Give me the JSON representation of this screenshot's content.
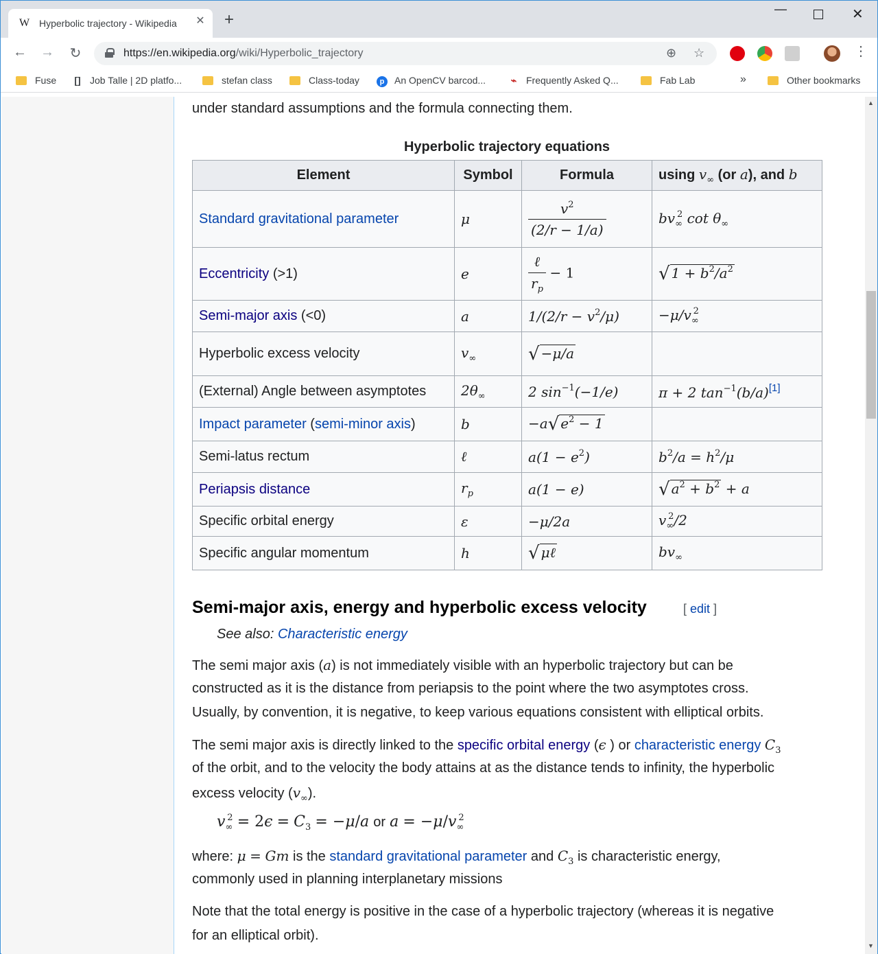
{
  "browser": {
    "tab_title": "Hyperbolic trajectory - Wikipedia",
    "tab_favicon": "W",
    "url_host": "https://en.wikipedia.org",
    "url_path": "/wiki/Hyperbolic_trajectory",
    "bookmarks": [
      {
        "label": "Fuse",
        "icon": "folder-icon"
      },
      {
        "label": "Job Talle | 2D platfo...",
        "icon": "bracket-icon"
      },
      {
        "label": "stefan class",
        "icon": "folder-icon"
      },
      {
        "label": "Class-today",
        "icon": "folder-icon"
      },
      {
        "label": "An OpenCV barcod...",
        "icon": "p-circle-icon"
      },
      {
        "label": "Frequently Asked Q...",
        "icon": "bookmark-graph-icon"
      },
      {
        "label": "Fab Lab",
        "icon": "folder-icon"
      }
    ],
    "bookmarks_overflow": "»",
    "other_bookmarks": "Other bookmarks"
  },
  "article": {
    "intro_tail": "under standard assumptions and the formula connecting them.",
    "table_caption": "Hyperbolic trajectory equations",
    "headers": {
      "element": "Element",
      "symbol": "Symbol",
      "formula": "Formula",
      "using_prefix": "using",
      "using_mid": "(or",
      "using_and": "), and"
    },
    "rows": {
      "r1": {
        "element": "Standard gravitational parameter"
      },
      "r2": {
        "element": "Eccentricity",
        "suffix": "(>1)"
      },
      "r3": {
        "element": "Semi-major axis",
        "suffix": "(<0)"
      },
      "r4": {
        "element": "Hyperbolic excess velocity"
      },
      "r5": {
        "element": "(External) Angle between asymptotes",
        "ref": "[1]"
      },
      "r6": {
        "element": "Impact parameter",
        "paren_link": "semi-minor axis"
      },
      "r7": {
        "element": "Semi-latus rectum"
      },
      "r8": {
        "element": "Periapsis distance"
      },
      "r9": {
        "element": "Specific orbital energy"
      },
      "r10": {
        "element": "Specific angular momentum"
      }
    },
    "section_title": "Semi-major axis, energy and hyperbolic excess velocity",
    "edit_link": "edit",
    "see_also_label": "See also:",
    "see_also_link": "Characteristic energy",
    "para1": {
      "l1a": "The semi major axis (",
      "l1b": ") is not immediately visible with an hyperbolic trajectory but can be",
      "l2": "constructed as it is the distance from periapsis to the point where the two asymptotes cross.",
      "l3": "Usually, by convention, it is negative, to keep various equations consistent with elliptical orbits."
    },
    "para2": {
      "l1a": "The semi major axis is directly linked to the",
      "l1link1": "specific orbital energy",
      "l1b": "(",
      "l1c": ") or",
      "l1link2": "characteristic energy",
      "l2": "of the orbit, and to the velocity the body attains at as the distance tends to infinity, the hyperbolic",
      "l3a": "excess velocity (",
      "l3b": ")."
    },
    "formula_or": "or",
    "para3": {
      "l1a": "where:",
      "l1b": "is the",
      "l1link": "standard gravitational parameter",
      "l1c": "and",
      "l1d": "is characteristic energy,",
      "l2": "commonly used in planning interplanetary missions"
    },
    "para4": {
      "l1": "Note that the total energy is positive in the case of a hyperbolic trajectory (whereas it is negative",
      "l2": "for an elliptical orbit)."
    }
  },
  "colors": {
    "link": "#0645ad",
    "visited_link": "#0b0080",
    "chrome_bg": "#dee1e6",
    "table_header": "#eaecf0"
  }
}
